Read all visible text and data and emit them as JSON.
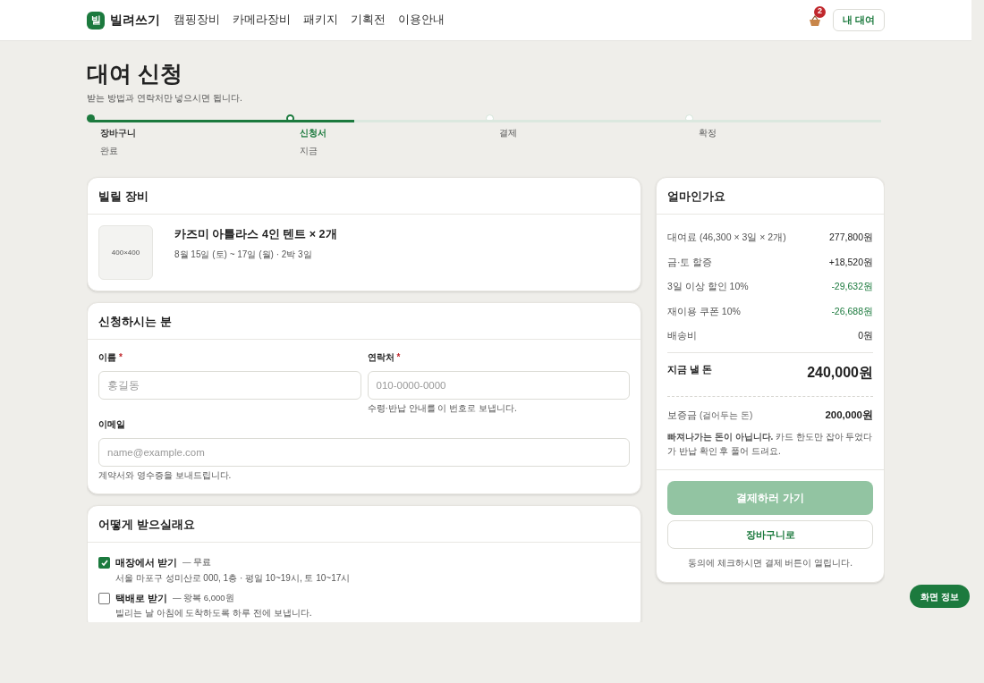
{
  "nav": {
    "logo_mark": "빌",
    "brand": "빌려쓰기",
    "links": [
      "캠핑장비",
      "카메라장비",
      "패키지",
      "기획전",
      "이용안내"
    ],
    "cart_count": "2",
    "my_button": "내 대여"
  },
  "page": {
    "title": "대여 신청",
    "subtitle": "받는 방법과 연락처만 넣으시면 됩니다."
  },
  "steps": [
    {
      "label": "장바구니",
      "note": "완료",
      "done": true,
      "selected": false
    },
    {
      "label": "신청서",
      "note": "지금",
      "done": false,
      "selected": true
    },
    {
      "label": "결제",
      "done": false,
      "selected": false
    },
    {
      "label": "확정",
      "done": false,
      "selected": false
    }
  ],
  "equipment": {
    "title": "빌릴 장비",
    "thumb_label": "400×400",
    "name": "카즈미 아틀라스 4인 텐트 × 2개",
    "dates": "8월 15일 (토) ~ 17일 (월) · 2박 3일"
  },
  "applicant": {
    "title": "신청하시는 분",
    "fields": [
      {
        "label": "이름",
        "required_mark": "*",
        "placeholder": "홍길동"
      },
      {
        "label": "연락처",
        "required_mark": "*",
        "placeholder": "010-0000-0000",
        "help": "수령·반납 안내를 이 번호로 보냅니다."
      },
      {
        "label": "이메일",
        "placeholder": "name@example.com",
        "help": "계약서와 영수증을 보내드립니다."
      }
    ]
  },
  "delivery": {
    "title": "어떻게 받으실래요",
    "options": [
      {
        "title": "매장에서 받기",
        "price": "— 무료",
        "detail": "서울 마포구 성미산로 000, 1층 · 평일 10~19시, 토 10~17시",
        "checked": true
      },
      {
        "title": "택배로 받기",
        "price": "— 왕복 6,000원",
        "detail": "빌리는 날 아침에 도착하도록 하루 전에 보냅니다.",
        "checked": false
      }
    ]
  },
  "summary": {
    "title": "얼마인가요",
    "rows": [
      {
        "label": "대여료 (46,300 × 3일 × 2개)",
        "amount": "277,800원",
        "discount": false
      },
      {
        "label": "금·토 할증",
        "amount": "+18,520원",
        "discount": false
      },
      {
        "label": "3일 이상 할인 10%",
        "amount": "-29,632원",
        "discount": true
      },
      {
        "label": "재이용 쿠폰 10%",
        "amount": "-26,688원",
        "discount": true
      },
      {
        "label": "배송비",
        "amount": "0원",
        "discount": false
      }
    ],
    "total_label": "지금 낼 돈",
    "total": "240,000원",
    "deposit_label": "보증금",
    "deposit_note": "(걸어두는 돈)",
    "deposit": "200,000원",
    "deposit_text": "**빠져나가는 돈이 아닙니다.** 카드 한도만 잡아 두었다가 반납 확인 후 풀어 드려요.",
    "pay_button": {
      "label": "결제하러 가기",
      "disabled": true
    },
    "cart_button": "장바구니로",
    "hint": "동의에 체크하시면 결제 버튼이 열립니다."
  },
  "info_button": "화면 정보"
}
